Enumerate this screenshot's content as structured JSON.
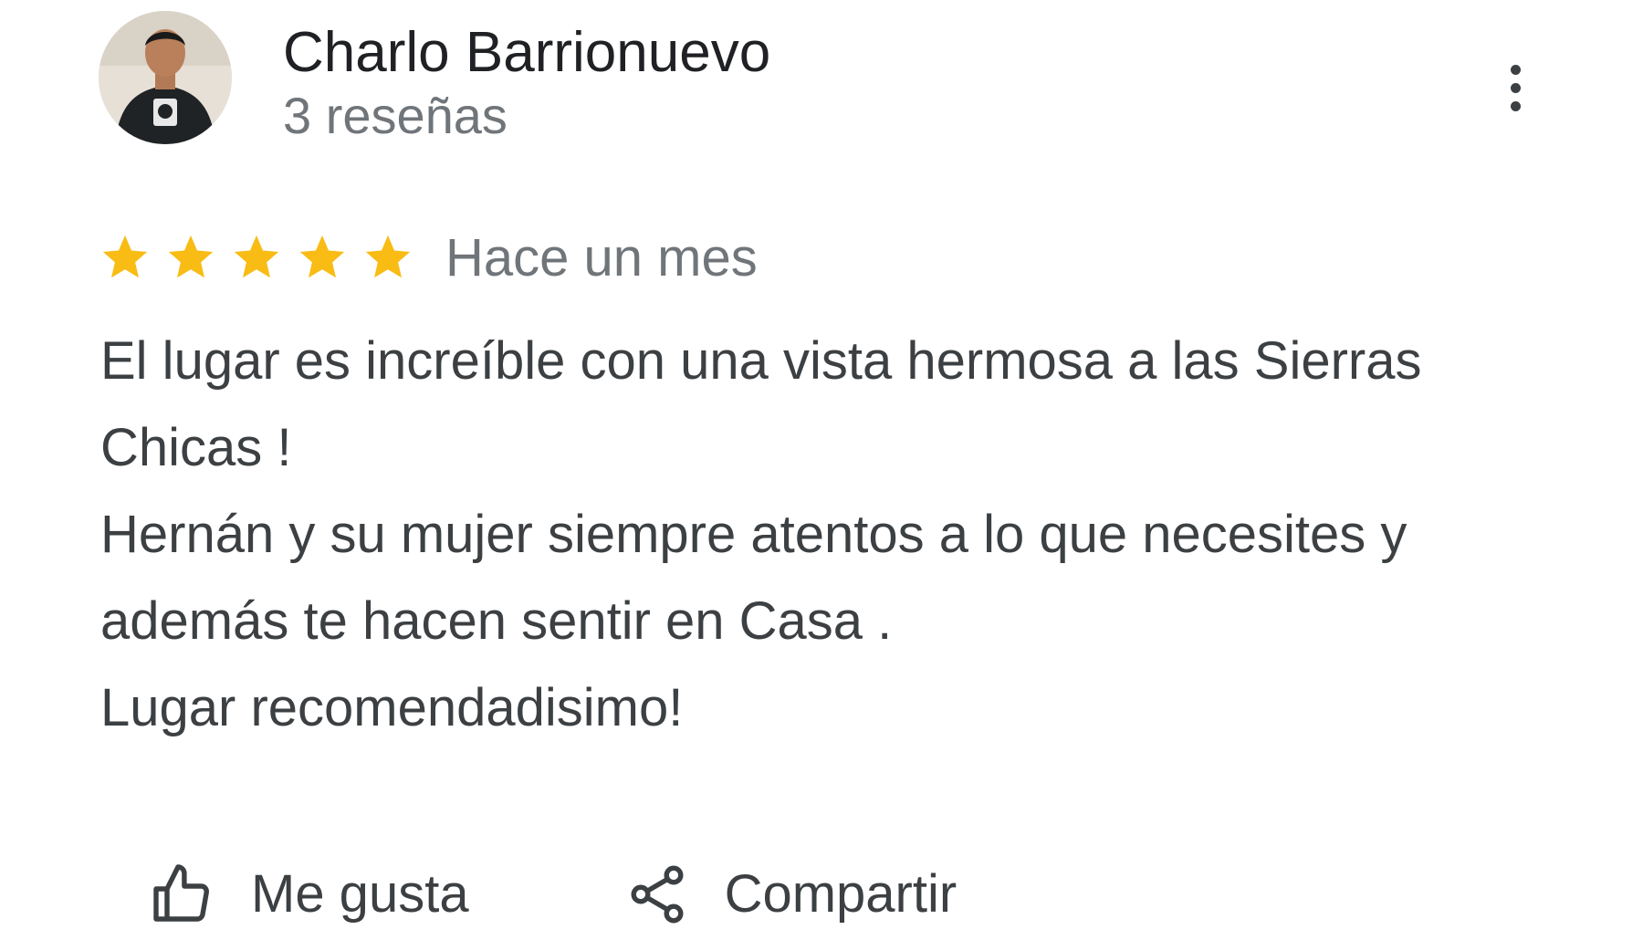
{
  "reviewer": {
    "name": "Charlo Barrionuevo",
    "review_count": "3 reseñas",
    "avatar_icon": "person-photo"
  },
  "menu": {
    "icon": "more-vertical-icon"
  },
  "review": {
    "rating": 5,
    "rating_max": 5,
    "star_color": "#F9BC15",
    "date": "Hace un mes",
    "text_lines": [
      "El lugar es increíble con una vista hermosa a las Sierras",
      "Chicas !",
      "Hernán y su mujer siempre atentos a lo que necesites y",
      "además te hacen sentir en Casa .",
      "Lugar recomendadisimo!"
    ]
  },
  "actions": {
    "like": {
      "label": "Me gusta",
      "icon": "thumbs-up-icon"
    },
    "share": {
      "label": "Compartir",
      "icon": "share-icon"
    }
  }
}
